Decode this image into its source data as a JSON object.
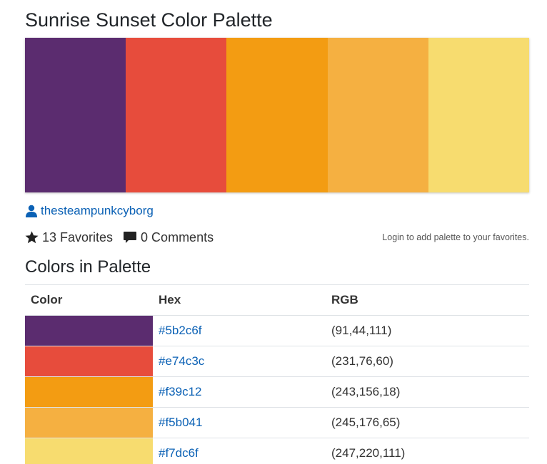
{
  "page": {
    "title": "Sunrise Sunset Color Palette"
  },
  "palette": {
    "swatches": [
      {
        "hex": "#5b2c6f"
      },
      {
        "hex": "#e74c3c"
      },
      {
        "hex": "#f39c12"
      },
      {
        "hex": "#f5b041"
      },
      {
        "hex": "#f7dc6f"
      }
    ]
  },
  "author": {
    "icon": "user-icon",
    "name": "thesteampunkcyborg"
  },
  "meta": {
    "favorites_icon": "star-icon",
    "favorites_label": "13 Favorites",
    "comments_icon": "comment-icon",
    "comments_label": "0 Comments",
    "login_note": "Login to add palette to your favorites."
  },
  "section": {
    "title": "Colors in Palette"
  },
  "table": {
    "headers": [
      "Color",
      "Hex",
      "RGB"
    ],
    "rows": [
      {
        "swatch": "#5b2c6f",
        "hex": "#5b2c6f",
        "rgb": "(91,44,111)"
      },
      {
        "swatch": "#e74c3c",
        "hex": "#e74c3c",
        "rgb": "(231,76,60)"
      },
      {
        "swatch": "#f39c12",
        "hex": "#f39c12",
        "rgb": "(243,156,18)"
      },
      {
        "swatch": "#f5b041",
        "hex": "#f5b041",
        "rgb": "(245,176,65)"
      },
      {
        "swatch": "#f7dc6f",
        "hex": "#f7dc6f",
        "rgb": "(247,220,111)"
      }
    ]
  }
}
